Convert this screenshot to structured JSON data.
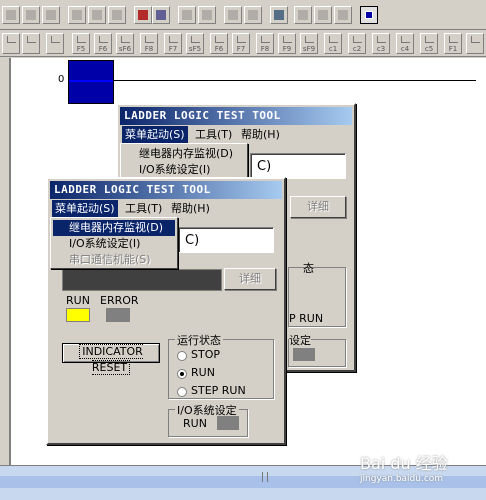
{
  "ladder": {
    "rung_number": "0"
  },
  "fkeys": [
    "F5",
    "F6",
    "sF6",
    "F8",
    "F7",
    "sF5",
    "F6",
    "F7",
    "F8",
    "F9",
    "sF9",
    "c1",
    "c2",
    "c3",
    "c4",
    "c5",
    "F1"
  ],
  "back_window": {
    "title": "LADDER LOGIC TEST TOOL",
    "menu": [
      "菜单起动(S)",
      "工具(T)",
      "帮助(H)"
    ],
    "dropdown_items": [
      "继电器内存监视(D)",
      "I/O系统设定(I)"
    ],
    "cpu_text": "C)",
    "detail_button": "详细",
    "mode_fragment": "态",
    "step_run_fragment": "P RUN",
    "io_fragment": "设定"
  },
  "front_window": {
    "title": "LADDER LOGIC TEST TOOL",
    "menu": {
      "start": "菜单起动(S)",
      "tools": "工具(T)",
      "help": "帮助(H)"
    },
    "dropdown": {
      "item1": "继电器内存监视(D)",
      "item2": "I/O系统设定(I)",
      "item3": "串口通信机能(S)"
    },
    "cpu_text": "C)",
    "detail_button": "详细",
    "run_label": "RUN",
    "error_label": "ERROR",
    "indicator_reset": "INDICATOR RESET",
    "run_state_group": "运行状态",
    "options": {
      "stop": "STOP",
      "run": "RUN",
      "step_run": "STEP RUN"
    },
    "selected_option": "RUN",
    "io_group": "I/O系统设定",
    "io_run_label": "RUN"
  },
  "colors": {
    "run_lamp": "#ffff00",
    "error_lamp": "#808080",
    "monitor_cell": "#0000a8"
  },
  "watermark": {
    "brand": "Bai du 经验",
    "url": "jingyan.baidu.com"
  }
}
